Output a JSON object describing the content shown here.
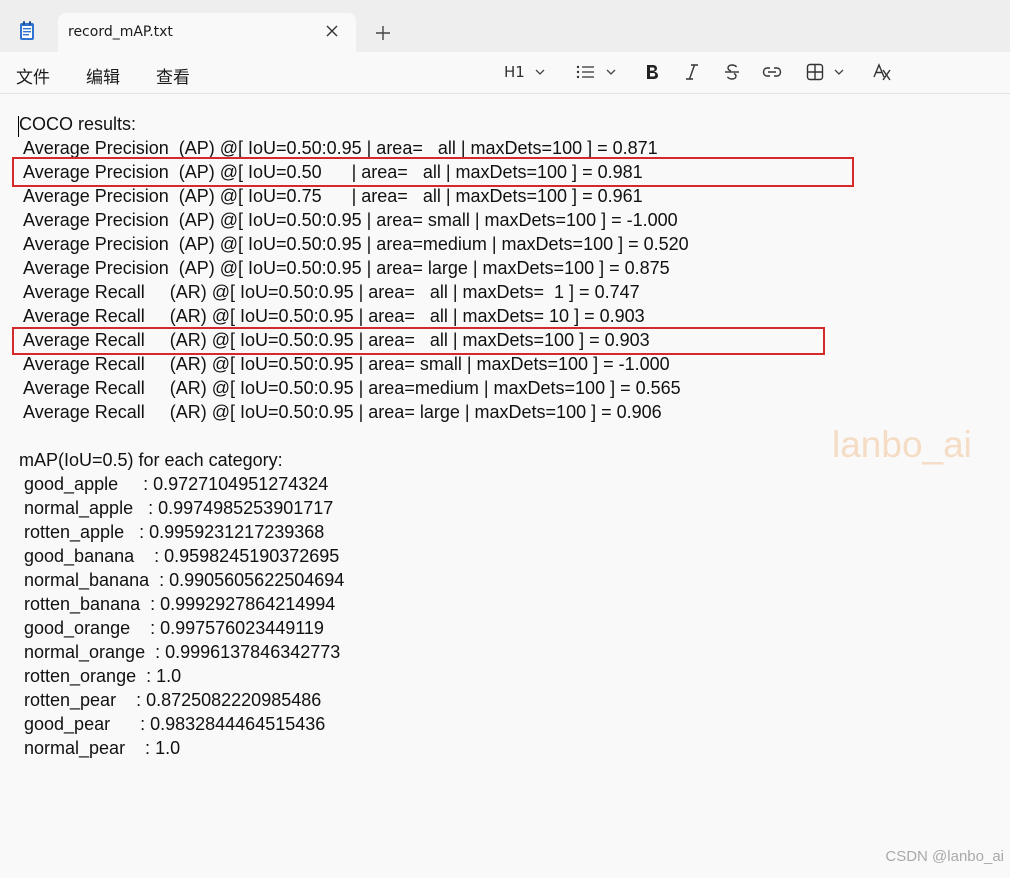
{
  "tab": {
    "title": "record_mAP.txt"
  },
  "menu": {
    "file": "文件",
    "edit": "编辑",
    "view": "查看"
  },
  "toolbar": {
    "heading": "H1"
  },
  "lines": [
    "COCO results:",
    " Average Precision  (AP) @[ IoU=0.50:0.95 | area=   all | maxDets=100 ] = 0.871",
    " Average Precision  (AP) @[ IoU=0.50      | area=   all | maxDets=100 ] = 0.981",
    " Average Precision  (AP) @[ IoU=0.75      | area=   all | maxDets=100 ] = 0.961",
    " Average Precision  (AP) @[ IoU=0.50:0.95 | area= small | maxDets=100 ] = -1.000",
    " Average Precision  (AP) @[ IoU=0.50:0.95 | area=medium | maxDets=100 ] = 0.520",
    " Average Precision  (AP) @[ IoU=0.50:0.95 | area= large | maxDets=100 ] = 0.875",
    " Average Recall     (AR) @[ IoU=0.50:0.95 | area=   all | maxDets=  1 ] = 0.747",
    " Average Recall     (AR) @[ IoU=0.50:0.95 | area=   all | maxDets= 10 ] = 0.903",
    " Average Recall     (AR) @[ IoU=0.50:0.95 | area=   all | maxDets=100 ] = 0.903",
    " Average Recall     (AR) @[ IoU=0.50:0.95 | area= small | maxDets=100 ] = -1.000",
    " Average Recall     (AR) @[ IoU=0.50:0.95 | area=medium | maxDets=100 ] = 0.565",
    " Average Recall     (AR) @[ IoU=0.50:0.95 | area= large | maxDets=100 ] = 0.906",
    "",
    "mAP(IoU=0.5) for each category:",
    " good_apple     : 0.9727104951274324",
    " normal_apple   : 0.9974985253901717",
    " rotten_apple   : 0.9959231217239368",
    " good_banana    : 0.9598245190372695",
    " normal_banana  : 0.9905605622504694",
    " rotten_banana  : 0.9992927864214994",
    " good_orange    : 0.997576023449119",
    " normal_orange  : 0.9996137846342773",
    " rotten_orange  : 1.0",
    " rotten_pear    : 0.8725082220985486",
    " good_pear      : 0.9832844464515436",
    " normal_pear    : 1.0"
  ],
  "watermark": "lanbo_ai",
  "footer_mark": "CSDN @lanbo_ai",
  "colors": {
    "highlight": "#d42a2a",
    "watermark": "#f5dcc4"
  }
}
